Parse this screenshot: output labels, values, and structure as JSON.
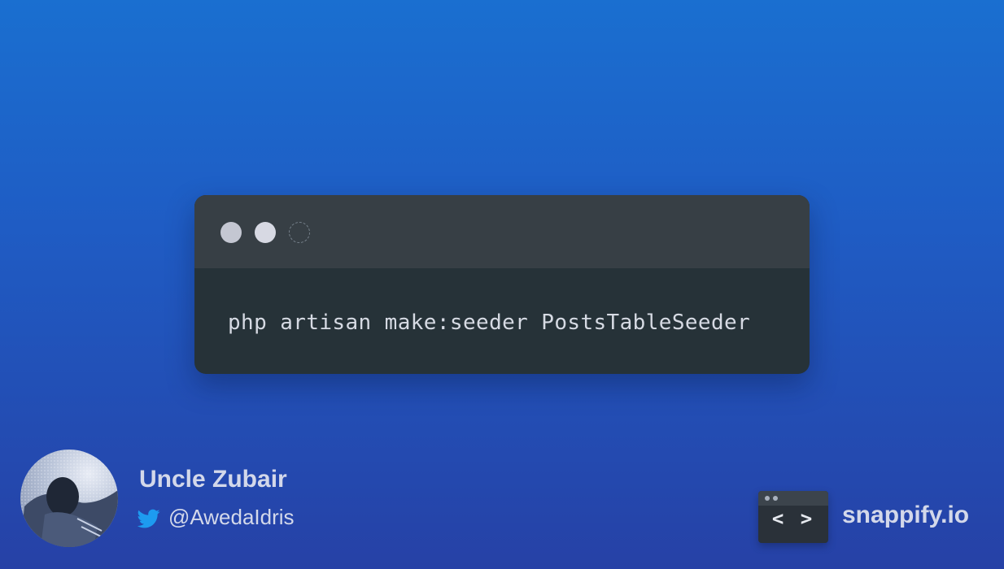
{
  "code_window": {
    "code": "php artisan make:seeder PostsTableSeeder"
  },
  "author": {
    "name": "Uncle Zubair",
    "handle": "@AwedaIdris",
    "handle_icon": "twitter-icon"
  },
  "branding": {
    "name": "snappify.io",
    "logo_text": "< >"
  },
  "colors": {
    "background_top": "#1a6fd0",
    "background_bottom": "#2641a6",
    "code_background": "#263238",
    "title_bar": "#373f45",
    "code_text": "#d6dae3",
    "footer_text": "#d3d8ea",
    "twitter_blue": "#1d9bf0"
  }
}
